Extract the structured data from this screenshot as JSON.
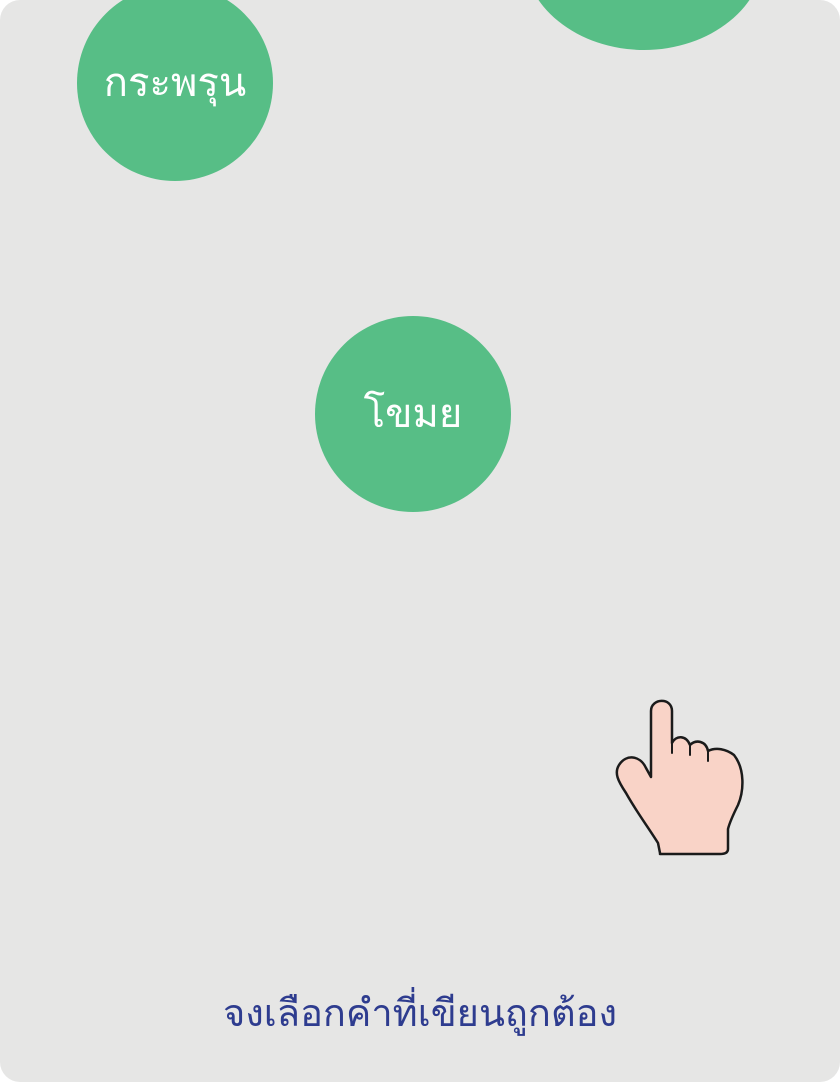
{
  "game": {
    "words": [
      {
        "text": "กระพรุน"
      },
      {
        "text": "โขมย"
      },
      {
        "text": ""
      }
    ],
    "instruction": "จงเลือกคำที่เขียนถูกต้อง",
    "colors": {
      "background": "#e6e6e5",
      "bubble": "#57be86",
      "bubble_text": "#ffffff",
      "instruction_text": "#2e3c8f",
      "hand_fill": "#f9d3c7"
    },
    "pointer_icon": "pointing-hand-icon"
  }
}
